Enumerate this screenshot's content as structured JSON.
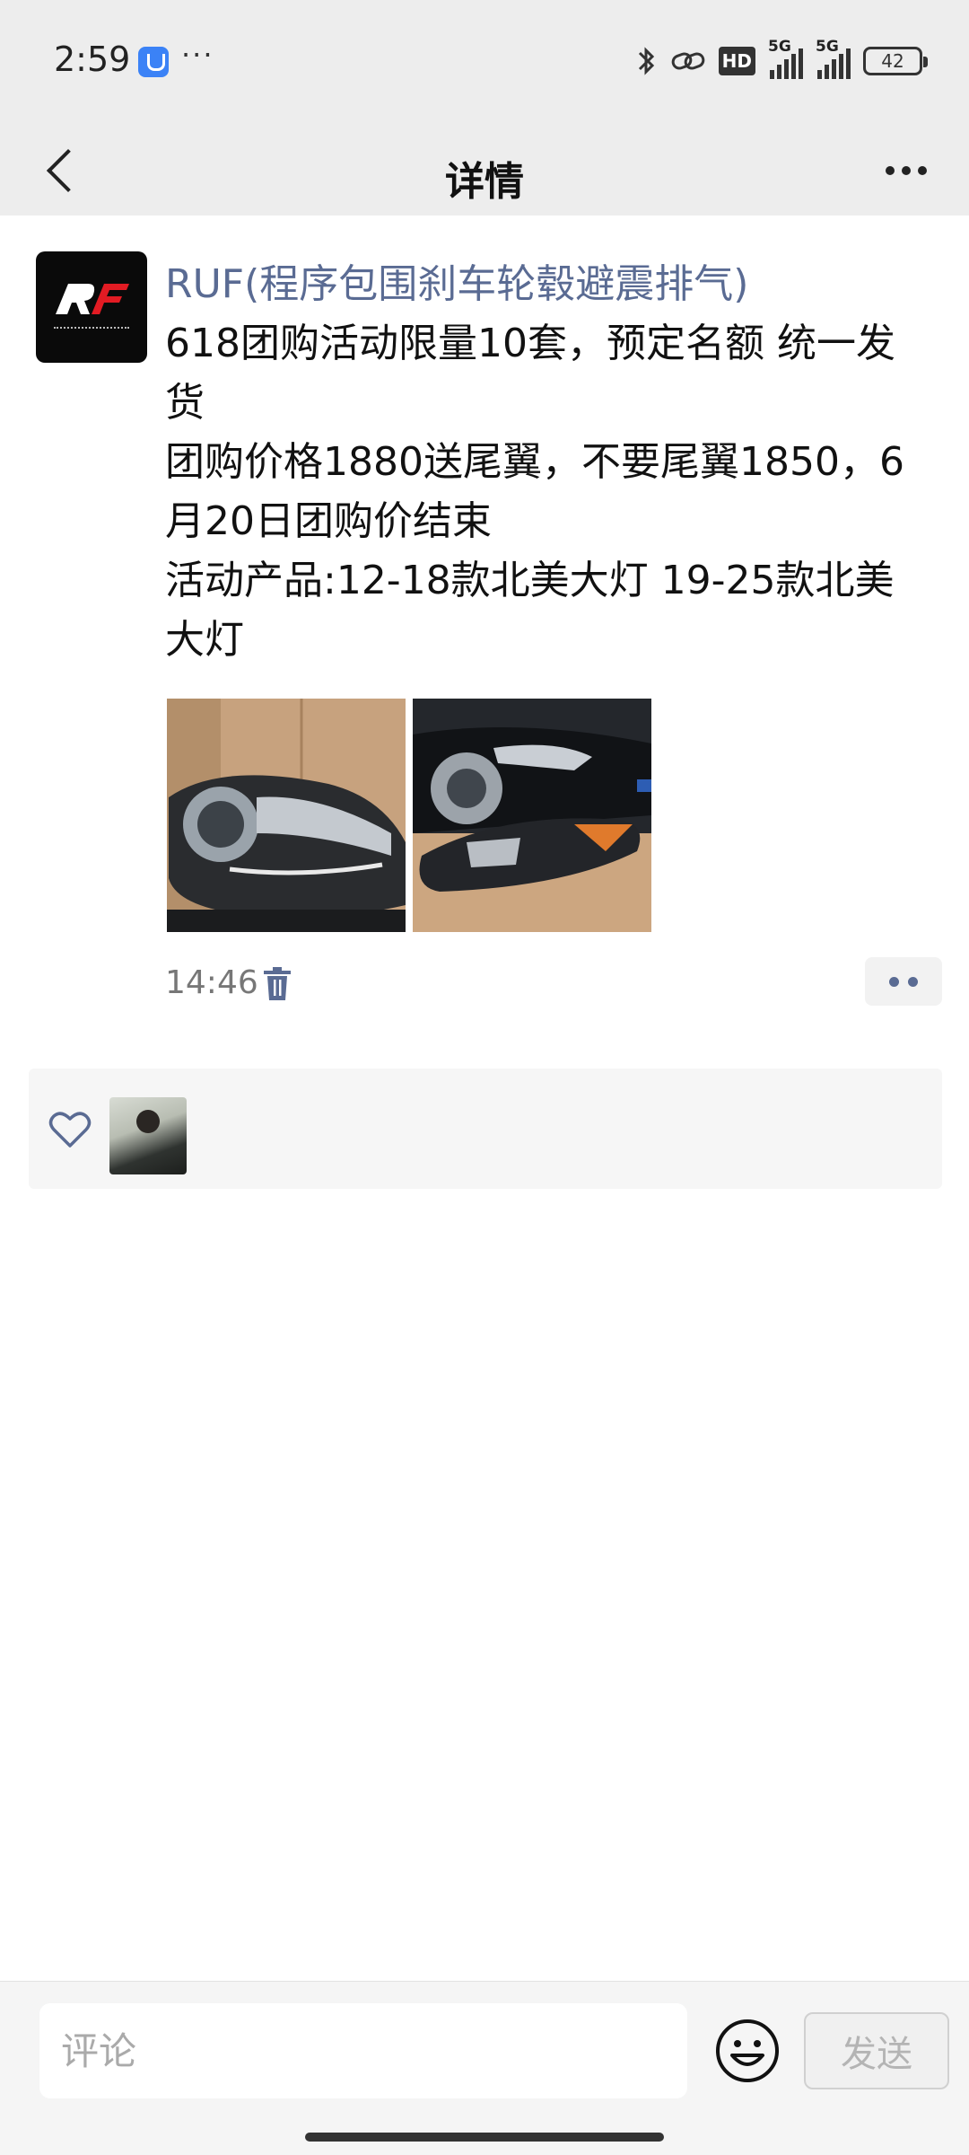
{
  "status_bar": {
    "time": "2:59",
    "overflow": "···",
    "hd_label": "HD",
    "signal1_label": "5G",
    "signal2_label": "5G",
    "battery": "42"
  },
  "navbar": {
    "title": "详情"
  },
  "post": {
    "author": "RUF(程序包围刹车轮毂避震排气)",
    "lines": [
      "618团购活动限量10套，预定名额  统一发货",
      "团购价格1880送尾翼，不要尾翼1850，6月20日团购价结束",
      "活动产品:12-18款北美大灯  19-25款北美大灯"
    ],
    "time": "14:46"
  },
  "comment_bar": {
    "placeholder": "评论",
    "send_label": "发送"
  },
  "colors": {
    "author_link": "#5a6b93",
    "nav_background": "#ededed",
    "likes_background": "#f6f6f6"
  }
}
